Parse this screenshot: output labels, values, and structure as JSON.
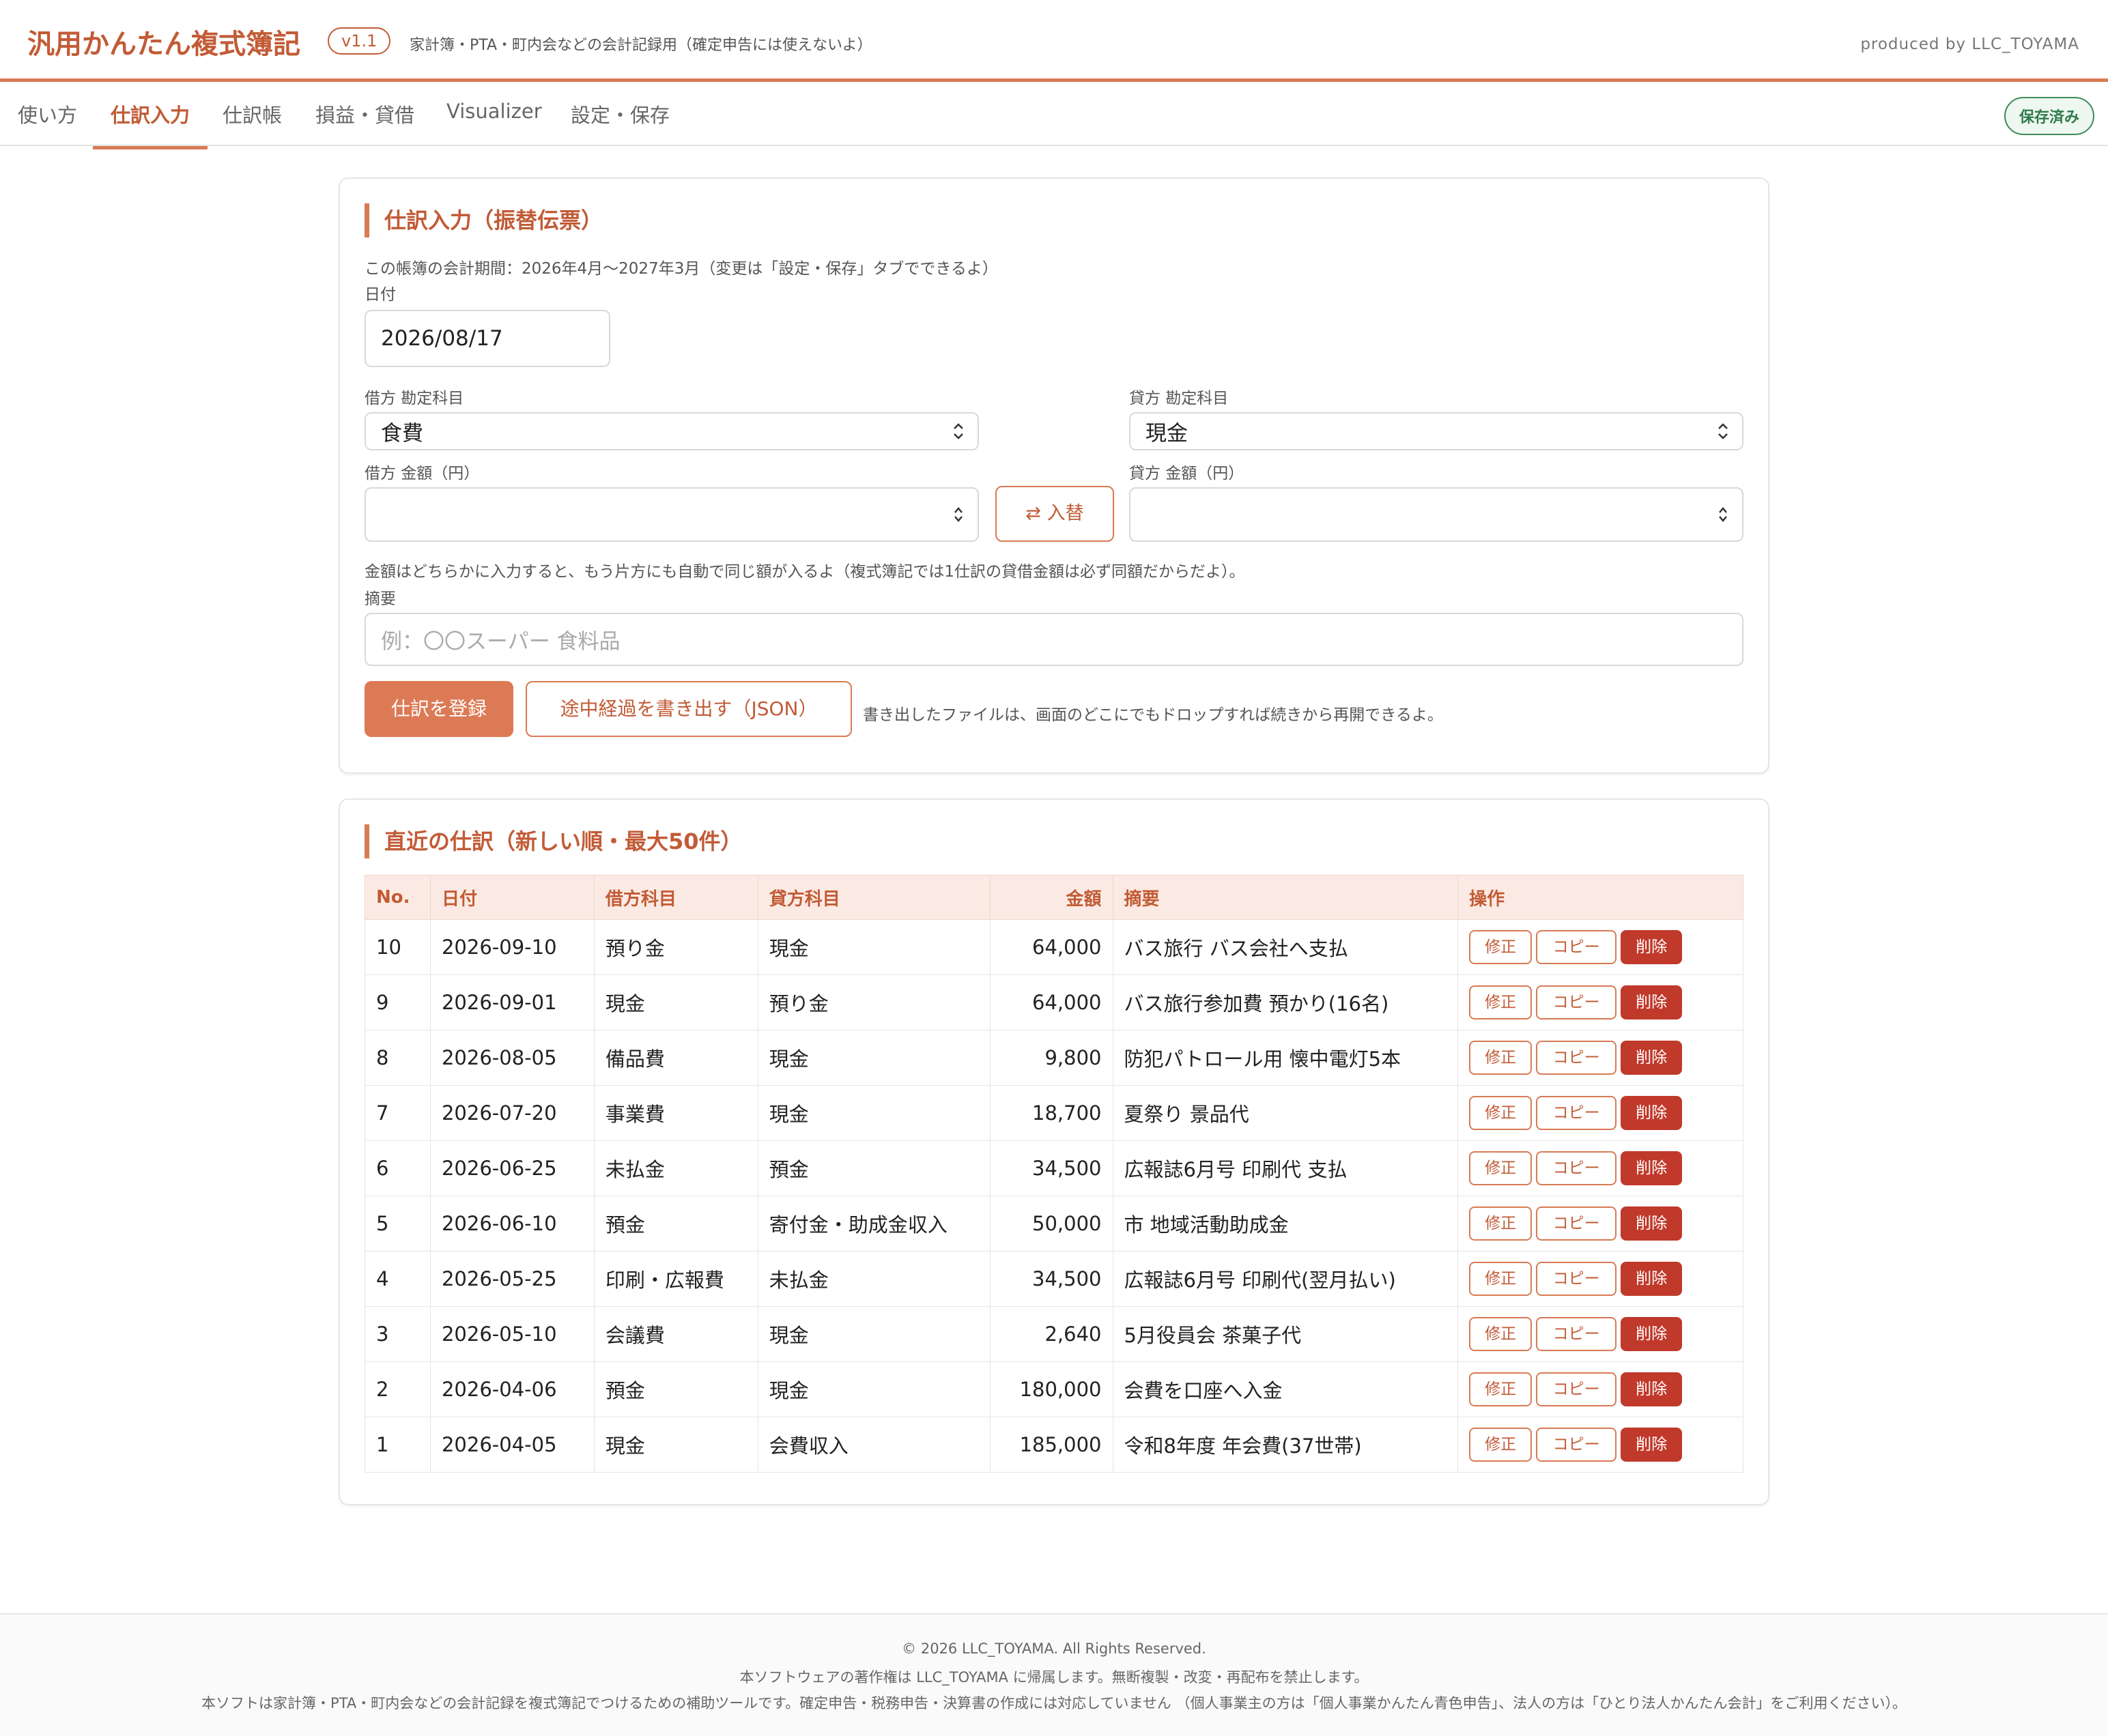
{
  "header": {
    "title": "汎用かんたん複式簿記",
    "version": "v1.1",
    "tagline": "家計簿・PTA・町内会などの会計記録用（確定申告には使えないよ）",
    "producer": "produced by LLC_TOYAMA"
  },
  "tabs": [
    {
      "label": "使い方"
    },
    {
      "label": "仕訳入力"
    },
    {
      "label": "仕訳帳"
    },
    {
      "label": "損益・貸借"
    },
    {
      "label": "Visualizer"
    },
    {
      "label": "設定・保存"
    }
  ],
  "active_tab": "仕訳入力",
  "save_status": "保存済み",
  "entry_form": {
    "title": "仕訳入力（振替伝票）",
    "period_note": "この帳簿の会計期間：2026年4月〜2027年3月（変更は「設定・保存」タブでできるよ）",
    "date_label": "日付",
    "date_value": "2026/08/17",
    "debit_account_label": "借方 勘定科目",
    "debit_account_value": "食費",
    "credit_account_label": "貸方 勘定科目",
    "credit_account_value": "現金",
    "debit_amount_label": "借方 金額（円）",
    "credit_amount_label": "貸方 金額（円）",
    "debit_amount_value": "",
    "credit_amount_value": "",
    "swap_label": "⇄ 入替",
    "amount_note": "金額はどちらかに入力すると、もう片方にも自動で同じ額が入るよ（複式簿記では1仕訳の貸借金額は必ず同額だからだよ）。",
    "memo_label": "摘要",
    "memo_placeholder": "例：〇〇スーパー 食料品",
    "register_label": "仕訳を登録",
    "export_label": "途中経過を書き出す（JSON）",
    "export_note": "書き出したファイルは、画面のどこにでもドロップすれば続きから再開できるよ。"
  },
  "recent": {
    "title": "直近の仕訳（新しい順・最大50件）",
    "columns": [
      "No.",
      "日付",
      "借方科目",
      "貸方科目",
      "金額",
      "摘要",
      "操作"
    ],
    "action_labels": {
      "edit": "修正",
      "copy": "コピー",
      "delete": "削除"
    },
    "rows": [
      {
        "no": "10",
        "date": "2026-09-10",
        "debit": "預り金",
        "credit": "現金",
        "amount": "64,000",
        "memo": "バス旅行 バス会社へ支払"
      },
      {
        "no": "9",
        "date": "2026-09-01",
        "debit": "現金",
        "credit": "預り金",
        "amount": "64,000",
        "memo": "バス旅行参加費 預かり(16名)"
      },
      {
        "no": "8",
        "date": "2026-08-05",
        "debit": "備品費",
        "credit": "現金",
        "amount": "9,800",
        "memo": "防犯パトロール用 懐中電灯5本"
      },
      {
        "no": "7",
        "date": "2026-07-20",
        "debit": "事業費",
        "credit": "現金",
        "amount": "18,700",
        "memo": "夏祭り 景品代"
      },
      {
        "no": "6",
        "date": "2026-06-25",
        "debit": "未払金",
        "credit": "預金",
        "amount": "34,500",
        "memo": "広報誌6月号 印刷代 支払"
      },
      {
        "no": "5",
        "date": "2026-06-10",
        "debit": "預金",
        "credit": "寄付金・助成金収入",
        "amount": "50,000",
        "memo": "市 地域活動助成金"
      },
      {
        "no": "4",
        "date": "2026-05-25",
        "debit": "印刷・広報費",
        "credit": "未払金",
        "amount": "34,500",
        "memo": "広報誌6月号 印刷代(翌月払い)"
      },
      {
        "no": "3",
        "date": "2026-05-10",
        "debit": "会議費",
        "credit": "現金",
        "amount": "2,640",
        "memo": "5月役員会 茶菓子代"
      },
      {
        "no": "2",
        "date": "2026-04-06",
        "debit": "預金",
        "credit": "現金",
        "amount": "180,000",
        "memo": "会費を口座へ入金"
      },
      {
        "no": "1",
        "date": "2026-04-05",
        "debit": "現金",
        "credit": "会費収入",
        "amount": "185,000",
        "memo": "令和8年度 年会費(37世帯)"
      }
    ]
  },
  "footer": {
    "copyright": "© 2026 LLC_TOYAMA. All Rights Reserved.",
    "rights": "本ソフトウェアの著作権は LLC_TOYAMA に帰属します。無断複製・改変・再配布を禁止します。",
    "disclaimer": "本ソフトは家計簿・PTA・町内会などの会計記録を複式簿記でつけるための補助ツールです。確定申告・税務申告・決算書の作成には対応していません （個人事業主の方は「個人事業かんたん青色申告」、法人の方は「ひとり法人かんたん会計」をご利用ください）。"
  },
  "colors": {
    "accent": "#d97a54",
    "accent_text": "#c25b36",
    "delete": "#c0392b",
    "saved": "#2f7a4b"
  },
  "icons": {
    "select_arrow": "updown-chevron-icon",
    "number_spinner": "spinner-icon"
  }
}
